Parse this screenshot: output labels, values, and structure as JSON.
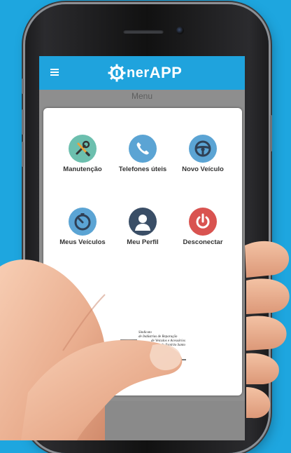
{
  "app": {
    "logo_small": "ner",
    "logo_big": "APP"
  },
  "page": {
    "title": "Menu"
  },
  "menu": {
    "items": [
      {
        "label": "Manutenção",
        "icon": "wrench-screwdriver-icon",
        "color": "#6cbfae"
      },
      {
        "label": "Telefones úteis",
        "icon": "phone-icon",
        "color": "#5ba4d4"
      },
      {
        "label": "Novo Veículo",
        "icon": "steering-wheel-icon",
        "color": "#5ba4d4"
      },
      {
        "label": "Meus Veículos",
        "icon": "timer-icon",
        "color": "#5ba4d4"
      },
      {
        "label": "Meu Perfil",
        "icon": "user-profile-icon",
        "color": "#3a4e66"
      },
      {
        "label": "Desconectar",
        "icon": "power-icon",
        "color": "#d95350"
      }
    ]
  },
  "sponsor": {
    "line1": "Sindicato",
    "line2": "de Indústrias de Reparação",
    "line3": "de Veículos e Acessórios",
    "line4": "do Espírito Santo"
  },
  "colors": {
    "background": "#1ea6df",
    "appbar": "#1fa3dd",
    "card": "#ffffff"
  }
}
